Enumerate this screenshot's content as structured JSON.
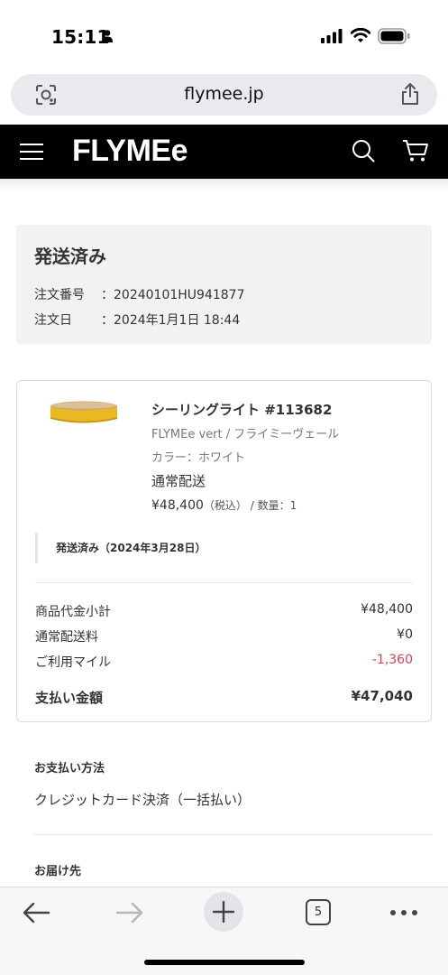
{
  "status_bar": {
    "time": "15:11"
  },
  "browser": {
    "url": "flymee.jp"
  },
  "site": {
    "logo": "FLYMEe"
  },
  "order_status": {
    "title": "発送済み",
    "order_number_label": "注文番号",
    "order_number": "20240101HU941877",
    "order_date_label": "注文日",
    "order_date": "2024年1月1日 18:44",
    "separator": "："
  },
  "product": {
    "name": "シーリングライト #113682",
    "brand": "FLYMEe vert / フライミーヴェール",
    "color": "カラー：ホワイト",
    "shipping_method": "通常配送",
    "price": "¥48,400",
    "tax_note": "（税込）",
    "quantity": " / 数量：1",
    "shipping_status": "発送済み（2024年3月28日）",
    "image_colors": {
      "shade": "#e8b923",
      "wood": "#c9a675"
    }
  },
  "summary": [
    {
      "label": "商品代金小計",
      "value": "¥48,400"
    },
    {
      "label": "通常配送料",
      "value": "¥0"
    },
    {
      "label": "ご利用マイル",
      "value": "-1,360"
    },
    {
      "label": "支払い金額",
      "value": "¥47,040"
    }
  ],
  "payment": {
    "label": "お支払い方法",
    "value": "クレジットカード決済（一括払い）"
  },
  "delivery": {
    "label": "お届け先"
  },
  "toolbar": {
    "tab_count": "5"
  },
  "colors": {
    "header_bg": "#000000",
    "negative": "#d9434b",
    "status_bg": "#f1f2f4"
  }
}
